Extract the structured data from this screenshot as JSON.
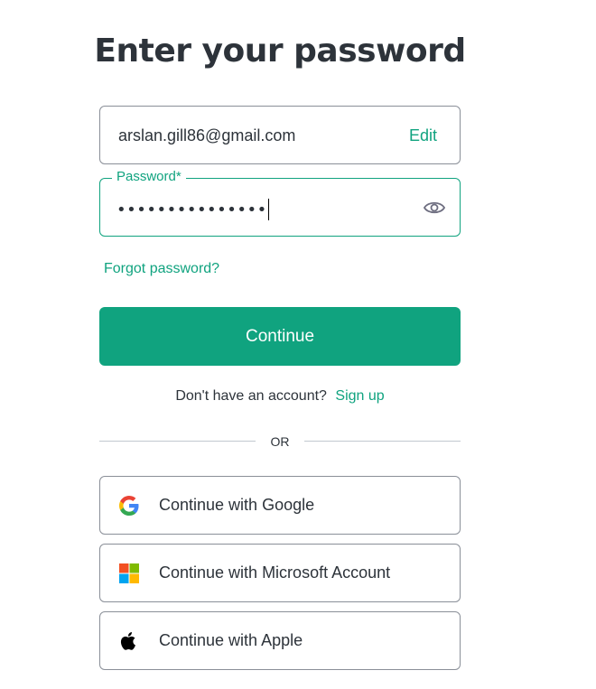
{
  "title": "Enter your password",
  "email": {
    "value": "arslan.gill86@gmail.com",
    "edit_label": "Edit"
  },
  "password": {
    "label": "Password*",
    "masked_value": "•••••••••••••••"
  },
  "forgot_label": "Forgot password?",
  "continue_label": "Continue",
  "signup": {
    "prompt": "Don't have an account?",
    "link": "Sign up"
  },
  "divider_text": "OR",
  "social": {
    "google": {
      "label": "Continue with Google",
      "icon": "google-icon"
    },
    "microsoft": {
      "label": "Continue with Microsoft Account",
      "icon": "microsoft-icon"
    },
    "apple": {
      "label": "Continue with Apple",
      "icon": "apple-icon"
    }
  },
  "colors": {
    "accent": "#10a37f",
    "text": "#2d333a",
    "border": "#8a8f98"
  }
}
